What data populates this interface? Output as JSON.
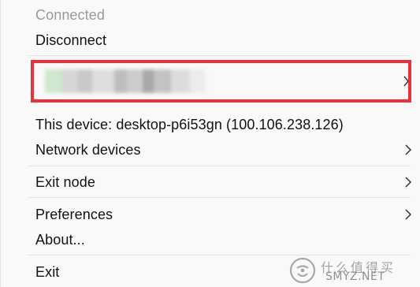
{
  "menu": {
    "status": "Connected",
    "disconnect": "Disconnect",
    "account": {
      "label": "",
      "redacted": true,
      "has_submenu": true,
      "highlight_color": "#e8323c"
    },
    "this_device": "This device: desktop-p6i53gn (100.106.238.126)",
    "network_devices": "Network devices",
    "exit_node": "Exit node",
    "preferences": "Preferences",
    "about": "About...",
    "exit": "Exit"
  },
  "icons": {
    "submenu": "chevron-right-icon",
    "watermark": "smzdm-logo-icon"
  },
  "watermark": {
    "chinese": "什么值得买",
    "site": "SMYZ.NET"
  }
}
